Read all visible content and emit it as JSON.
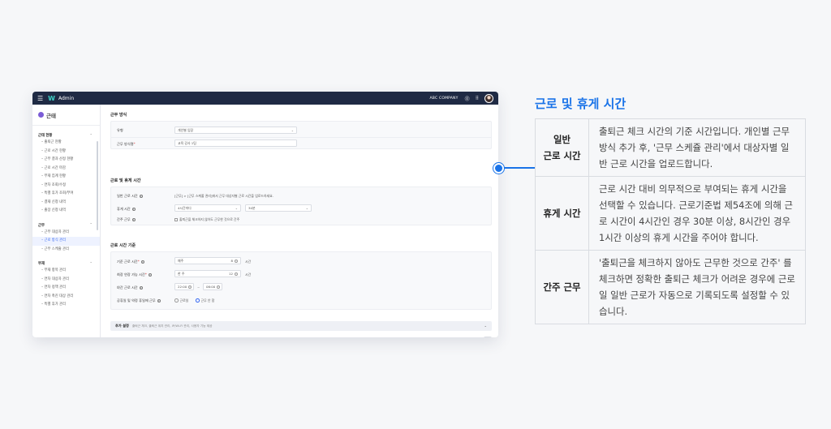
{
  "app": {
    "title": "Admin",
    "company": "ABC COMPANY",
    "menu_icon": "hamburger-icon",
    "help_icon": "help-icon",
    "apps_icon": "grid-icon"
  },
  "sidebar": {
    "brand": "근태",
    "sections": [
      {
        "title": "근태 현황",
        "items": [
          "출퇴근 현황",
          "근로 시간 현황",
          "근무 결과 산정 현황",
          "근로 시간 마감",
          "부재 집계 현황",
          "연차 조회/수정",
          "특별 휴가 조회/부여",
          "결재 신청 내역",
          "출장 신청 내역"
        ]
      },
      {
        "title": "근무",
        "items": [
          "근무 대상자 관리",
          "근로 방식 관리",
          "근무 스케줄 관리"
        ]
      },
      {
        "title": "부재",
        "items": [
          "부재 항목 관리",
          "연차 대상자 관리",
          "연차 정책 관리",
          "연차 촉진 대상 관리",
          "특별 휴가 관리"
        ]
      }
    ],
    "active_item": "근로 방식 관리"
  },
  "main": {
    "section1": {
      "title": "근무 방식",
      "type_label": "유형",
      "type_value": "개인별 입장",
      "name_label": "근무 방식명",
      "name_value": "교육 강사 1팀"
    },
    "section2": {
      "title": "근로 및 휴게 시간",
      "general_label": "일반 근로 시간",
      "general_text": "[근무] > [근무 스케줄 관리]에서 근무 대상자별 근로 시간을 업로드하세요.",
      "break_label": "휴게 시간",
      "break_value1": "4시간마다",
      "break_value2": "30분",
      "deemed_label": "간주 근무",
      "deemed_text": "출퇴근을 체크하지 않아도 근무한 것으로 간주"
    },
    "section3": {
      "title": "근로 시간 기준",
      "std_label": "기준 근로 시간",
      "std_prefix": "매주",
      "std_value": "8",
      "std_unit": "시간",
      "max_label": "최장 연장 가능 시간",
      "max_prefix": "한 주",
      "max_value": "12",
      "max_unit": "시간",
      "night_label": "야간 근로 시간",
      "night_start": "22:00",
      "night_sep": "~",
      "night_end": "06:00",
      "holiday_label": "공휴일 및 약정 휴일에 근무",
      "holiday_opt1": "근로일",
      "holiday_opt2": "근무 안 함"
    },
    "extra": {
      "title": "추가 설정",
      "desc": "출퇴근 체크, 출퇴근 위치 관리, IP/Wi-Fi 관리, 사용자 기능 제공"
    }
  },
  "info": {
    "title": "근로 및 휴게 시간",
    "rows": [
      {
        "key_line1": "일반",
        "key_line2": "근로 시간",
        "value": "출퇴근 체크 시간의 기준 시간입니다. 개인별 근무 방식 추가 후, '근무 스케쥴 관리'에서 대상자별 일반 근로 시간을 업로드합니다."
      },
      {
        "key_line1": "휴게 시간",
        "key_line2": "",
        "value": "근로 시간 대비 의무적으로 부여되는 휴게 시간을 선택할 수 있습니다. 근로기준법 제54조에 의해 근로 시간이 4시간인 경우 30분 이상, 8시간인 경우 1시간 이상의 휴게 시간을 주어야 합니다."
      },
      {
        "key_line1": "간주 근무",
        "key_line2": "",
        "value": "'출퇴근을 체크하지 않아도 근무한 것으로 간주' 를 체크하면 정확한 출퇴근 체크가 어려운 경우에 근로일 일반 근로가 자동으로 기록되도록 설정할 수 있습니다."
      }
    ]
  },
  "colors": {
    "accent": "#1a73e8",
    "nav": "#1f2a44",
    "active_bg": "#eef2ff"
  }
}
